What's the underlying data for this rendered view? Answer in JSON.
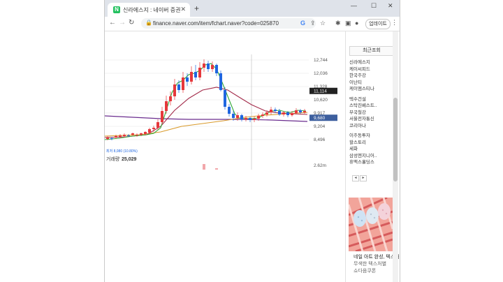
{
  "browser": {
    "tab_title": "신라에스지 : 네이버 증권",
    "tab_icon_text": "N",
    "new_tab": "+",
    "close_tab": "✕",
    "win_min": "—",
    "win_max": "☐",
    "win_close": "✕",
    "url": "finance.naver.com/item/fchart.naver?code=025870",
    "update_button": "업데이트"
  },
  "chart": {
    "price_labels": [
      "12,744",
      "12,036",
      "11,328",
      "10,620",
      "9,917",
      "9,204",
      "8,496"
    ],
    "current_price": "11,114",
    "last_price": "9,680",
    "volume_label": "거래량",
    "volume_value": "25,029",
    "volume_max": "2.62m",
    "min_marker": "최저 8,080 (10.80%)",
    "x_labels": [
      "12월",
      "14",
      "2023",
      "14",
      "2월",
      "14"
    ],
    "crosshair_date": "2023-02-02"
  },
  "chart_data": {
    "type": "candlestick",
    "y_ticks": [
      12744,
      12036,
      11328,
      10620,
      9917,
      9204,
      8496
    ],
    "current": 11114,
    "last": 9680,
    "low_marker": 8080,
    "x_labels": [
      "12월",
      "14",
      "2023",
      "14",
      "2월",
      "14"
    ],
    "crosshair": "2023-02-02",
    "volume_axis_max": "2.62m",
    "series_colors": {
      "up": "#e6383c",
      "down": "#1f66e0",
      "ma5": "#2fa836",
      "ma20": "#a32b4a",
      "ma60": "#d99a2b",
      "ma120": "#6a2c8e"
    }
  },
  "sidebar": {
    "title": "최근조회",
    "group1": [
      "신라에스지",
      "케이씨피드",
      "한국주강",
      "이난티",
      "케이엠스티나"
    ],
    "group2": [
      "텍수건설",
      "스탁진베스트..",
      "부국철강",
      "서울전자통신",
      "코리아나"
    ],
    "group3": [
      "이주동투자",
      "할스토리",
      "세화",
      "삼성엔지니어..",
      "휴맥스홀딩스"
    ],
    "prev": "◂",
    "next": "▸"
  },
  "ad": {
    "title": "네일 아트 완성, 텍스처",
    "subtitle": "무색한 텍스처별",
    "more": "쇼다음쿠폰"
  }
}
